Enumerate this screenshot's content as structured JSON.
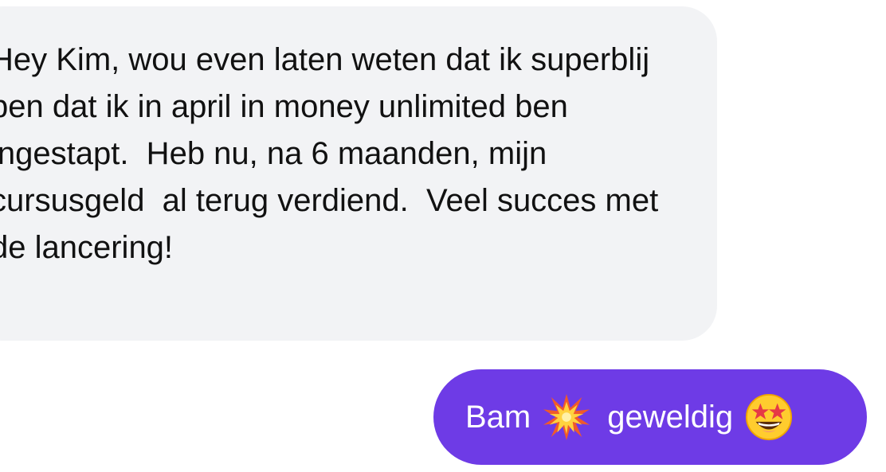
{
  "conversation": {
    "incoming": {
      "text": "Hey Kim, wou even laten weten dat ik superblij ben dat ik in april in money unlimited ben ingestapt.  Heb nu, na 6 maanden, mijn cursusgeld  al terug verdiend.  Veel succes met de lancering!"
    },
    "outgoing": {
      "word_1": "Bam",
      "emoji_1": "collision-emoji",
      "word_2": "geweldig",
      "emoji_2": "star-struck-emoji",
      "color": "#6e3be6"
    }
  },
  "colors": {
    "incoming_bubble": "#f2f3f5",
    "incoming_text": "#111111",
    "outgoing_bubble": "#6e3be6",
    "outgoing_text": "#ffffff"
  }
}
